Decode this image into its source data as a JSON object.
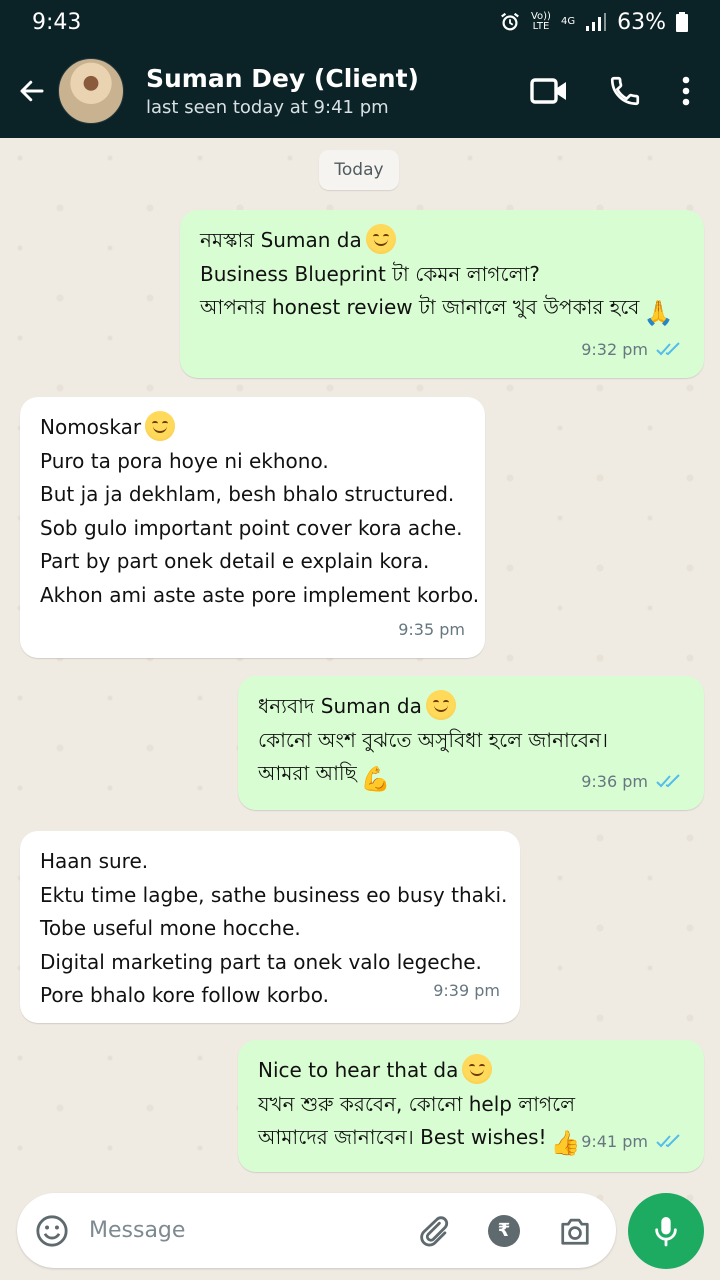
{
  "status_bar": {
    "time": "9:43",
    "volte_top": "Vo))",
    "volte_bottom": "LTE",
    "network": "4G",
    "battery": "63%"
  },
  "header": {
    "contact_name": "Suman Dey (Client)",
    "last_seen": "last seen today at 9:41 pm"
  },
  "date_chip": "Today",
  "messages": [
    {
      "direction": "out",
      "lines": [
        "নমস্কার Suman da",
        "Business Blueprint টা কেমন লাগলো?",
        "আপনার honest review টা জানালে খুব উপকার হবে"
      ],
      "time": "9:32 pm",
      "read": true
    },
    {
      "direction": "in",
      "lines": [
        "Nomoskar",
        "Puro ta pora hoye ni ekhono.",
        "But ja ja dekhlam, besh bhalo structured.",
        "Sob gulo important point cover kora ache.",
        "Part by part onek detail e explain kora.",
        "Akhon ami aste aste pore implement korbo."
      ],
      "time": "9:35 pm"
    },
    {
      "direction": "out",
      "lines": [
        "ধন্যবাদ Suman da",
        "কোনো অংশ বুঝতে অসুবিধা হলে জানাবেন।",
        "আমরা আছি"
      ],
      "time": "9:36 pm",
      "read": true
    },
    {
      "direction": "in",
      "lines": [
        "Haan sure.",
        "Ektu time lagbe, sathe business eo busy thaki.",
        "Tobe useful mone hocche.",
        "Digital marketing part ta onek valo legeche.",
        "Pore bhalo kore follow korbo."
      ],
      "time": "9:39 pm"
    },
    {
      "direction": "out",
      "lines": [
        "Nice to hear that da",
        "যখন শুরু করবেন, কোনো help লাগলে",
        "আমাদের জানাবেন। Best wishes!"
      ],
      "time": "9:41 pm",
      "read": true
    }
  ],
  "composer": {
    "placeholder": "Message"
  },
  "colors": {
    "header_bg": "#0b2227",
    "outgoing_bubble": "#d9fdd3",
    "incoming_bubble": "#ffffff",
    "read_tick": "#53bdeb",
    "mic_button": "#1daa61"
  }
}
